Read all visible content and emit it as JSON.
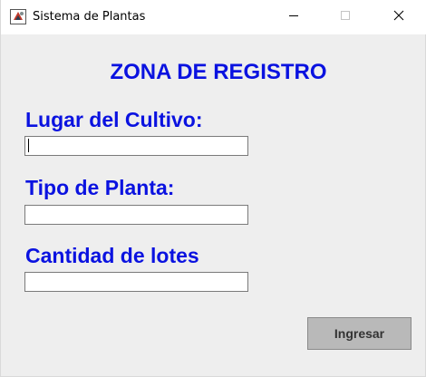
{
  "window": {
    "title": "Sistema de Plantas",
    "controls": {
      "minimize_icon": "minimize-icon",
      "maximize_icon": "maximize-icon",
      "close_icon": "close-icon"
    },
    "app_icon": "java-app-icon"
  },
  "form": {
    "heading": "ZONA DE REGISTRO",
    "fields": [
      {
        "label": "Lugar del Cultivo:",
        "value": "",
        "placeholder": ""
      },
      {
        "label": "Tipo de Planta:",
        "value": "",
        "placeholder": ""
      },
      {
        "label": "Cantidad de lotes",
        "value": "",
        "placeholder": ""
      }
    ],
    "submit_label": "Ingresar"
  },
  "colors": {
    "label_color": "#0a12e0",
    "window_background": "#eeeeee",
    "button_background": "#b9b9b9"
  }
}
